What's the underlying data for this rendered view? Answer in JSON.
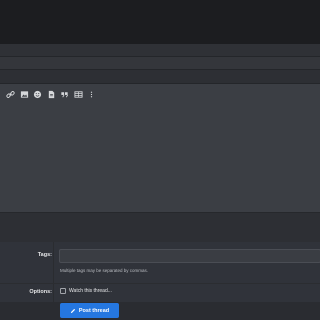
{
  "toolbar": {
    "icons": [
      "link-icon",
      "image-icon",
      "emoji-icon",
      "file-icon",
      "quote-icon",
      "table-icon",
      "more-options-icon"
    ]
  },
  "tags": {
    "label": "Tags:",
    "value": "",
    "hint": "Multiple tags may be separated by commas."
  },
  "options": {
    "label": "Options:",
    "watch_label": "Watch this thread..."
  },
  "submit": {
    "label": "Post thread"
  },
  "colors": {
    "accent": "#2577e0",
    "background": "#2b2d31",
    "topbar": "#1c1d20"
  }
}
